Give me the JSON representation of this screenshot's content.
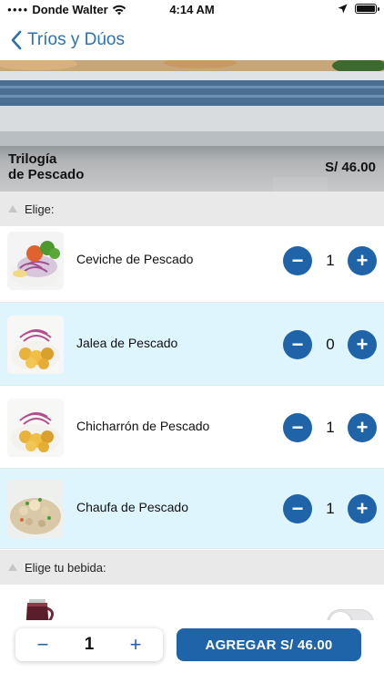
{
  "status_bar": {
    "carrier": "Donde Walter",
    "time": "4:14 AM"
  },
  "nav": {
    "back_label": "Tríos y Dúos"
  },
  "hero": {
    "title_line1": "Trilogía",
    "title_line2": "de Pescado",
    "price": "S/ 46.00"
  },
  "sections": {
    "choose": "Elige:",
    "drink": "Elige tu bebida:"
  },
  "items": [
    {
      "name": "Ceviche de Pescado",
      "quantity": "1",
      "minus": "−",
      "plus": "+"
    },
    {
      "name": "Jalea de Pescado",
      "quantity": "0",
      "minus": "−",
      "plus": "+"
    },
    {
      "name": "Chicharrón de Pescado",
      "quantity": "1",
      "minus": "−",
      "plus": "+"
    },
    {
      "name": "Chaufa de Pescado",
      "quantity": "1",
      "minus": "−",
      "plus": "+"
    }
  ],
  "drink": {
    "toggle_on": false
  },
  "bottom": {
    "quantity": "1",
    "minus": "−",
    "plus": "+",
    "add_label": "AGREGAR S/ 46.00"
  },
  "colors": {
    "accent": "#1f64a8",
    "link": "#2b71b5",
    "alt_row": "#dff5fd",
    "section_bg": "#e9e9ea"
  }
}
